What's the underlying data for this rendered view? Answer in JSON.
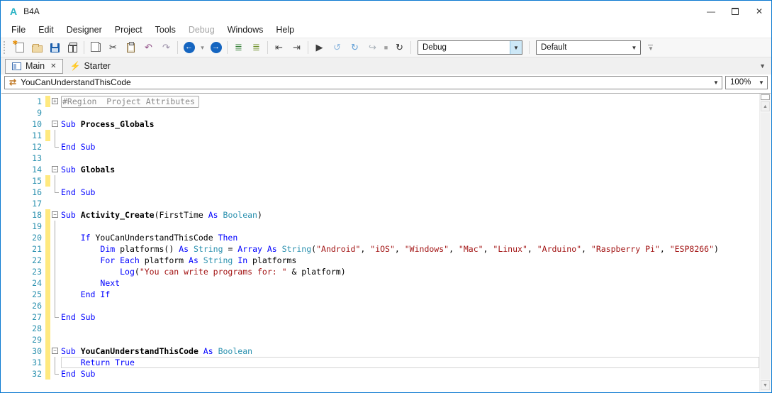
{
  "window": {
    "logo_letter": "A",
    "title": "B4A",
    "controls": [
      {
        "name": "minimize-button",
        "glyph": "—"
      },
      {
        "name": "maximize-button",
        "glyph": "box"
      },
      {
        "name": "close-button",
        "glyph": "✕"
      }
    ]
  },
  "menu": {
    "items": [
      {
        "label": "File",
        "enabled": true
      },
      {
        "label": "Edit",
        "enabled": true
      },
      {
        "label": "Designer",
        "enabled": true
      },
      {
        "label": "Project",
        "enabled": true
      },
      {
        "label": "Tools",
        "enabled": true
      },
      {
        "label": "Debug",
        "enabled": false
      },
      {
        "label": "Windows",
        "enabled": true
      },
      {
        "label": "Help",
        "enabled": true
      }
    ]
  },
  "toolbar": {
    "buttons": [
      {
        "name": "new-button",
        "kind": "css",
        "icon": "ic-new"
      },
      {
        "name": "open-button",
        "kind": "css",
        "icon": "ic-open"
      },
      {
        "name": "save-button",
        "kind": "css",
        "icon": "ic-save"
      },
      {
        "name": "modules-button",
        "kind": "css",
        "icon": "ic-pkg"
      },
      {
        "sep": true
      },
      {
        "name": "copy-button",
        "kind": "css",
        "icon": "ic-copy"
      },
      {
        "name": "cut-button",
        "kind": "glyph",
        "glyph": "✂",
        "color": "#3a3a3a"
      },
      {
        "name": "paste-button",
        "kind": "css",
        "icon": "ic-paste"
      },
      {
        "name": "undo-button",
        "kind": "glyph",
        "glyph": "↶",
        "color": "#8e4a84"
      },
      {
        "name": "redo-button",
        "kind": "glyph",
        "glyph": "↷",
        "color": "#9a8fa8"
      },
      {
        "sep": true
      },
      {
        "name": "navigate-back-button",
        "kind": "circle",
        "glyph": "←"
      },
      {
        "name": "navigate-back-dropdown",
        "kind": "glyph",
        "glyph": "▾",
        "color": "#888",
        "small": true
      },
      {
        "name": "navigate-forward-button",
        "kind": "circle",
        "glyph": "→"
      },
      {
        "sep": true
      },
      {
        "name": "comment-button",
        "kind": "glyph",
        "glyph": "≣",
        "color": "#2f7d31"
      },
      {
        "name": "uncomment-button",
        "kind": "glyph",
        "glyph": "≣",
        "color": "#6b8e23"
      },
      {
        "sep": true
      },
      {
        "name": "outdent-button",
        "kind": "glyph",
        "glyph": "⇤",
        "color": "#444"
      },
      {
        "name": "indent-button",
        "kind": "glyph",
        "glyph": "⇥",
        "color": "#444"
      },
      {
        "sep": true
      },
      {
        "name": "run-button",
        "kind": "glyph",
        "glyph": "▶",
        "color": "#3c3c3c"
      },
      {
        "name": "step-into-button",
        "kind": "glyph",
        "glyph": "↺",
        "color": "#8fb8df"
      },
      {
        "name": "step-over-button",
        "kind": "glyph",
        "glyph": "↻",
        "color": "#5f9ed6"
      },
      {
        "name": "step-out-button",
        "kind": "glyph",
        "glyph": "↪",
        "color": "#a8b0b8"
      },
      {
        "name": "stop-button",
        "kind": "glyph",
        "glyph": "■",
        "color": "#a0a0a0",
        "small": true
      },
      {
        "name": "restart-button",
        "kind": "glyph",
        "glyph": "↻",
        "color": "#2f2f2f"
      },
      {
        "sep": true
      }
    ],
    "build_config_combo": {
      "value": "Debug",
      "arrow_highlight": true
    },
    "filter_combo": {
      "value": "Default",
      "arrow_highlight": false
    }
  },
  "tabs": [
    {
      "label": "Main",
      "icon": "form-icon",
      "active": true,
      "closable": true,
      "close_glyph": "✕"
    },
    {
      "label": "Starter",
      "icon": "lightning-icon",
      "active": false,
      "closable": false
    }
  ],
  "navbar": {
    "member": "YouCanUnderstandThisCode",
    "zoom": "100%"
  },
  "editor": {
    "lines": [
      {
        "num": 1,
        "bar": true,
        "fold": "+",
        "segs": [
          [
            "r",
            "#Region  Project Attributes"
          ]
        ]
      },
      {
        "num": 9,
        "bar": false,
        "fold": "",
        "segs": []
      },
      {
        "num": 10,
        "bar": false,
        "fold": "-",
        "segs": [
          [
            "k",
            "Sub "
          ],
          [
            "n",
            "Process_Globals"
          ]
        ]
      },
      {
        "num": 11,
        "bar": true,
        "fold": "g",
        "segs": []
      },
      {
        "num": 12,
        "bar": false,
        "fold": "e",
        "segs": [
          [
            "k",
            "End Sub"
          ]
        ]
      },
      {
        "num": 13,
        "bar": false,
        "fold": "",
        "segs": []
      },
      {
        "num": 14,
        "bar": false,
        "fold": "-",
        "segs": [
          [
            "k",
            "Sub "
          ],
          [
            "n",
            "Globals"
          ]
        ]
      },
      {
        "num": 15,
        "bar": true,
        "fold": "g",
        "segs": []
      },
      {
        "num": 16,
        "bar": false,
        "fold": "e",
        "segs": [
          [
            "k",
            "End Sub"
          ]
        ]
      },
      {
        "num": 17,
        "bar": false,
        "fold": "",
        "segs": []
      },
      {
        "num": 18,
        "bar": true,
        "fold": "-",
        "segs": [
          [
            "k",
            "Sub "
          ],
          [
            "n",
            "Activity_Create"
          ],
          [
            "p",
            "(FirstTime "
          ],
          [
            "k",
            "As "
          ],
          [
            "t",
            "Boolean"
          ],
          [
            "p",
            ")"
          ]
        ]
      },
      {
        "num": 19,
        "bar": true,
        "fold": "g",
        "segs": []
      },
      {
        "num": 20,
        "bar": true,
        "fold": "g",
        "segs": [
          [
            "p",
            "\t"
          ],
          [
            "k",
            "If "
          ],
          [
            "p",
            "YouCanUnderstandThisCode "
          ],
          [
            "k",
            "Then"
          ]
        ]
      },
      {
        "num": 21,
        "bar": true,
        "fold": "g",
        "segs": [
          [
            "p",
            "\t\t"
          ],
          [
            "k",
            "Dim "
          ],
          [
            "p",
            "platforms() "
          ],
          [
            "k",
            "As "
          ],
          [
            "t",
            "String "
          ],
          [
            "p",
            "= "
          ],
          [
            "k",
            "Array As "
          ],
          [
            "t",
            "String"
          ],
          [
            "p",
            "("
          ],
          [
            "s",
            "\"Android\""
          ],
          [
            "p",
            ", "
          ],
          [
            "s",
            "\"iOS\""
          ],
          [
            "p",
            ", "
          ],
          [
            "s",
            "\"Windows\""
          ],
          [
            "p",
            ", "
          ],
          [
            "s",
            "\"Mac\""
          ],
          [
            "p",
            ", "
          ],
          [
            "s",
            "\"Linux\""
          ],
          [
            "p",
            ", "
          ],
          [
            "s",
            "\"Arduino\""
          ],
          [
            "p",
            ", "
          ],
          [
            "s",
            "\"Raspberry Pi\""
          ],
          [
            "p",
            ", "
          ],
          [
            "s",
            "\"ESP8266\""
          ],
          [
            "p",
            ")"
          ]
        ]
      },
      {
        "num": 22,
        "bar": true,
        "fold": "g",
        "segs": [
          [
            "p",
            "\t\t"
          ],
          [
            "k",
            "For Each "
          ],
          [
            "p",
            "platform "
          ],
          [
            "k",
            "As "
          ],
          [
            "t",
            "String "
          ],
          [
            "k",
            "In "
          ],
          [
            "p",
            "platforms"
          ]
        ]
      },
      {
        "num": 23,
        "bar": true,
        "fold": "g",
        "segs": [
          [
            "p",
            "\t\t\t"
          ],
          [
            "k",
            "Log"
          ],
          [
            "p",
            "("
          ],
          [
            "s",
            "\"You can write programs for: \""
          ],
          [
            "p",
            " & platform)"
          ]
        ]
      },
      {
        "num": 24,
        "bar": true,
        "fold": "g",
        "segs": [
          [
            "p",
            "\t\t"
          ],
          [
            "k",
            "Next"
          ]
        ]
      },
      {
        "num": 25,
        "bar": true,
        "fold": "g",
        "segs": [
          [
            "p",
            "\t"
          ],
          [
            "k",
            "End If"
          ]
        ]
      },
      {
        "num": 26,
        "bar": true,
        "fold": "g",
        "segs": []
      },
      {
        "num": 27,
        "bar": true,
        "fold": "e",
        "segs": [
          [
            "k",
            "End Sub"
          ]
        ]
      },
      {
        "num": 28,
        "bar": true,
        "fold": "",
        "segs": []
      },
      {
        "num": 29,
        "bar": true,
        "fold": "",
        "segs": []
      },
      {
        "num": 30,
        "bar": true,
        "fold": "-",
        "segs": [
          [
            "k",
            "Sub "
          ],
          [
            "n",
            "YouCanUnderstandThisCode "
          ],
          [
            "k",
            "As "
          ],
          [
            "t",
            "Boolean"
          ]
        ]
      },
      {
        "num": 31,
        "bar": true,
        "fold": "g",
        "cur": true,
        "segs": [
          [
            "p",
            "\t"
          ],
          [
            "k",
            "Return True"
          ]
        ]
      },
      {
        "num": 32,
        "bar": true,
        "fold": "e",
        "segs": [
          [
            "k",
            "End Sub"
          ]
        ]
      }
    ]
  },
  "colors": {
    "window_border": "#0b79d0",
    "logo_teal": "#27b2c4",
    "keyword_blue": "#0000ff",
    "type_teal": "#2b91af",
    "string_red": "#a31515",
    "line_number_teal": "#2b91af",
    "change_bar_yellow": "#ffe97f",
    "nav_circle_blue": "#1565c0",
    "lightning_orange": "#e8762c",
    "combo_arrow_highlight": "#cde8f7"
  }
}
